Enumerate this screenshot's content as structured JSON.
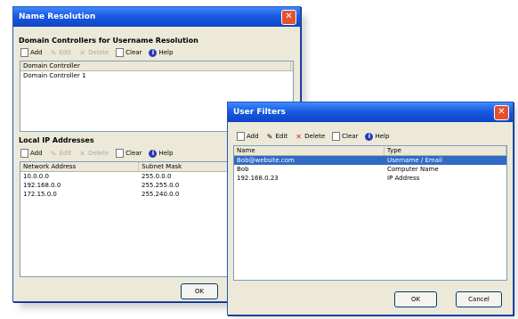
{
  "win1": {
    "title": "Name Resolution",
    "dc_section": "Domain Controllers for Username Resolution",
    "dc_toolbar": {
      "add": "Add",
      "edit": "Edit",
      "delete": "Delete",
      "clear": "Clear",
      "help": "Help"
    },
    "dc_header": "Domain Controller",
    "dc_rows": [
      "Domain Controller 1"
    ],
    "ip_section": "Local IP Addresses",
    "ip_toolbar": {
      "add": "Add",
      "edit": "Edit",
      "delete": "Delete",
      "clear": "Clear",
      "help": "Help"
    },
    "ip_headers": [
      "Network Address",
      "Subnet Mask"
    ],
    "ip_rows": [
      [
        "10.0.0.0",
        "255.0.0.0"
      ],
      [
        "192.168.0.0",
        "255.255.0.0"
      ],
      [
        "172.15.0.0",
        "255.240.0.0"
      ]
    ],
    "ok": "OK"
  },
  "win2": {
    "title": "User Filters",
    "toolbar": {
      "add": "Add",
      "edit": "Edit",
      "delete": "Delete",
      "clear": "Clear",
      "help": "Help"
    },
    "headers": [
      "Name",
      "Type"
    ],
    "rows": [
      [
        "Bob@website.com",
        "Username / Email"
      ],
      [
        "Bob",
        "Computer Name"
      ],
      [
        "192.168.0.23",
        "IP Address"
      ]
    ],
    "ok": "OK",
    "cancel": "Cancel"
  }
}
